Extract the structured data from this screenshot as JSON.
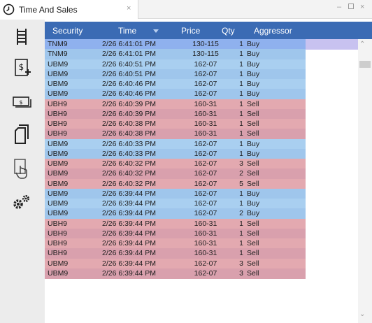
{
  "window": {
    "tab_title": "Time And Sales",
    "tab_close": "×",
    "min_glyph": "–",
    "close_glyph": "×"
  },
  "toolbar": {
    "icons": [
      "ladder-icon",
      "new-order-icon",
      "cash-icon",
      "copy-icon",
      "touch-icon",
      "settings-icon"
    ]
  },
  "columns": {
    "security": "Security",
    "time": "Time",
    "price": "Price",
    "qty": "Qty",
    "aggressor": "Aggressor"
  },
  "colors": {
    "header": "#3b6bb4",
    "buy_row": "#a9cff0",
    "buy_row_alt": "#9fc6ec",
    "sell_row": "#e3a9b0",
    "sell_row_alt": "#d9a0ad",
    "selected_row": "#8fb1ee"
  },
  "rows": [
    {
      "security": "TNM9",
      "time": "2/26 6:41:01 PM",
      "price": "130-115",
      "qty": "1",
      "aggressor": "Buy",
      "side": "buy"
    },
    {
      "security": "TNM9",
      "time": "2/26 6:41:01 PM",
      "price": "130-115",
      "qty": "1",
      "aggressor": "Buy",
      "side": "buy"
    },
    {
      "security": "UBM9",
      "time": "2/26 6:40:51 PM",
      "price": "162-07",
      "qty": "1",
      "aggressor": "Buy",
      "side": "buy"
    },
    {
      "security": "UBM9",
      "time": "2/26 6:40:51 PM",
      "price": "162-07",
      "qty": "1",
      "aggressor": "Buy",
      "side": "buy"
    },
    {
      "security": "UBM9",
      "time": "2/26 6:40:46 PM",
      "price": "162-07",
      "qty": "1",
      "aggressor": "Buy",
      "side": "buy"
    },
    {
      "security": "UBM9",
      "time": "2/26 6:40:46 PM",
      "price": "162-07",
      "qty": "1",
      "aggressor": "Buy",
      "side": "buy"
    },
    {
      "security": "UBH9",
      "time": "2/26 6:40:39 PM",
      "price": "160-31",
      "qty": "1",
      "aggressor": "Sell",
      "side": "sell"
    },
    {
      "security": "UBH9",
      "time": "2/26 6:40:39 PM",
      "price": "160-31",
      "qty": "1",
      "aggressor": "Sell",
      "side": "sell"
    },
    {
      "security": "UBH9",
      "time": "2/26 6:40:38 PM",
      "price": "160-31",
      "qty": "1",
      "aggressor": "Sell",
      "side": "sell"
    },
    {
      "security": "UBH9",
      "time": "2/26 6:40:38 PM",
      "price": "160-31",
      "qty": "1",
      "aggressor": "Sell",
      "side": "sell"
    },
    {
      "security": "UBM9",
      "time": "2/26 6:40:33 PM",
      "price": "162-07",
      "qty": "1",
      "aggressor": "Buy",
      "side": "buy"
    },
    {
      "security": "UBM9",
      "time": "2/26 6:40:33 PM",
      "price": "162-07",
      "qty": "1",
      "aggressor": "Buy",
      "side": "buy"
    },
    {
      "security": "UBM9",
      "time": "2/26 6:40:32 PM",
      "price": "162-07",
      "qty": "3",
      "aggressor": "Sell",
      "side": "sell"
    },
    {
      "security": "UBM9",
      "time": "2/26 6:40:32 PM",
      "price": "162-07",
      "qty": "2",
      "aggressor": "Sell",
      "side": "sell"
    },
    {
      "security": "UBM9",
      "time": "2/26 6:40:32 PM",
      "price": "162-07",
      "qty": "5",
      "aggressor": "Sell",
      "side": "sell"
    },
    {
      "security": "UBM9",
      "time": "2/26 6:39:44 PM",
      "price": "162-07",
      "qty": "1",
      "aggressor": "Buy",
      "side": "buy"
    },
    {
      "security": "UBM9",
      "time": "2/26 6:39:44 PM",
      "price": "162-07",
      "qty": "1",
      "aggressor": "Buy",
      "side": "buy"
    },
    {
      "security": "UBM9",
      "time": "2/26 6:39:44 PM",
      "price": "162-07",
      "qty": "2",
      "aggressor": "Buy",
      "side": "buy"
    },
    {
      "security": "UBH9",
      "time": "2/26 6:39:44 PM",
      "price": "160-31",
      "qty": "1",
      "aggressor": "Sell",
      "side": "sell"
    },
    {
      "security": "UBH9",
      "time": "2/26 6:39:44 PM",
      "price": "160-31",
      "qty": "1",
      "aggressor": "Sell",
      "side": "sell"
    },
    {
      "security": "UBH9",
      "time": "2/26 6:39:44 PM",
      "price": "160-31",
      "qty": "1",
      "aggressor": "Sell",
      "side": "sell"
    },
    {
      "security": "UBH9",
      "time": "2/26 6:39:44 PM",
      "price": "160-31",
      "qty": "1",
      "aggressor": "Sell",
      "side": "sell"
    },
    {
      "security": "UBM9",
      "time": "2/26 6:39:44 PM",
      "price": "162-07",
      "qty": "3",
      "aggressor": "Sell",
      "side": "sell"
    },
    {
      "security": "UBM9",
      "time": "2/26 6:39:44 PM",
      "price": "162-07",
      "qty": "3",
      "aggressor": "Sell",
      "side": "sell"
    }
  ]
}
